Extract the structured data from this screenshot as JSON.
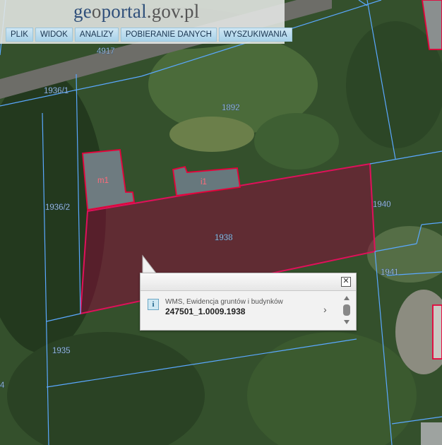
{
  "app": {
    "logo_geo": "ge",
    "logo_o": "o",
    "logo_rest": "portal",
    "logo_domain": ".gov.pl"
  },
  "menu": {
    "items": [
      "PLIK",
      "WIDOK",
      "ANALIZY",
      "POBIERANIE DANYCH",
      "WYSZUKIWANIA"
    ]
  },
  "map_labels": {
    "p4917": "4917",
    "p1936_1": "1936/1",
    "p1892": "1892",
    "p1936_2": "1936/2",
    "p1940": "1940",
    "p1938": "1938",
    "p1941": "1941",
    "p1935": "1935",
    "b_m1": "m1",
    "b_i1": "i1",
    "edge_4": "4"
  },
  "popup": {
    "info_icon": "i",
    "layer_name": "WMS, Ewidencja gruntów i budynków",
    "feature_id": "247501_1.0009.1938"
  },
  "colors": {
    "parcel_line": "#5aa8ff",
    "selected_parcel": "#e0105a",
    "building_outline": "#e8003a"
  }
}
